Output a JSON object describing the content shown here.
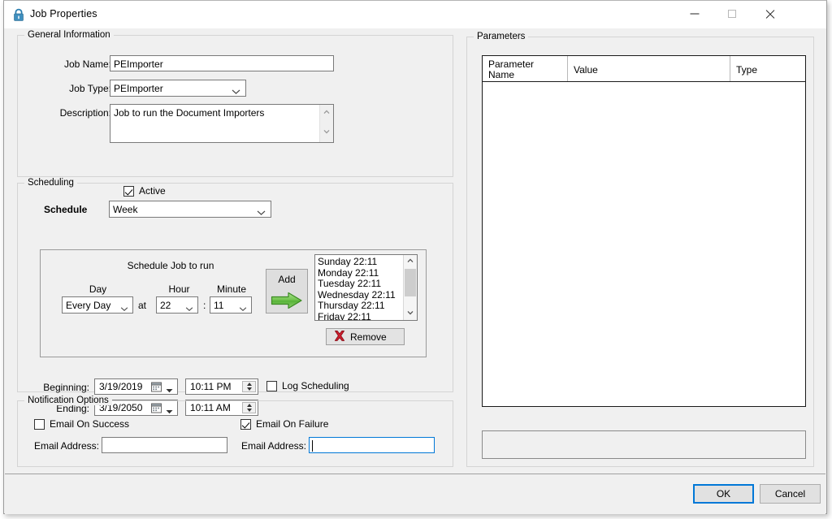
{
  "window": {
    "title": "Job Properties",
    "lock_icon": "lock-icon",
    "minimize_label": "Minimize",
    "maximize_label": "Maximize",
    "close_label": "Close"
  },
  "general": {
    "legend": "General Information",
    "job_name_label": "Job Name:",
    "job_name_value": "PEImporter",
    "job_type_label": "Job Type:",
    "job_type_value": "PEImporter",
    "description_label": "Description:",
    "description_value": "Job to run the Document Importers",
    "active_label": "Active",
    "active_checked": true
  },
  "scheduling": {
    "legend": "Scheduling",
    "schedule_label": "Schedule",
    "schedule_value": "Week",
    "panel_title": "Schedule Job to run",
    "day_label": "Day",
    "hour_label": "Hour",
    "minute_label": "Minute",
    "day_value": "Every Day",
    "at_label": "at",
    "colon_label": ":",
    "hour_value": "22",
    "minute_value": "11",
    "add_label": "Add",
    "add_icon": "green-arrow-right-icon",
    "remove_label": "Remove",
    "remove_icon": "red-x-icon",
    "entries": [
      "Sunday 22:11",
      "Monday 22:11",
      "Tuesday 22:11",
      "Wednesday 22:11",
      "Thursday 22:11",
      "Friday 22:11"
    ],
    "beginning_label": "Beginning:",
    "beginning_date": "3/19/2019",
    "beginning_time": "10:11 PM",
    "ending_label": "Ending:",
    "ending_date": "3/19/2050",
    "ending_time": "10:11 AM",
    "log_scheduling_label": "Log Scheduling",
    "log_scheduling_checked": false
  },
  "notification": {
    "legend": "Notification Options",
    "email_on_success_label": "Email On Success",
    "email_on_success_checked": false,
    "email_on_failure_label": "Email On Failure",
    "email_on_failure_checked": true,
    "success_address_label": "Email Address:",
    "success_address_value": "",
    "failure_address_label": "Email Address:",
    "failure_address_value": ""
  },
  "parameters": {
    "legend": "Parameters",
    "columns": [
      "Parameter\nName",
      "Value",
      "Type"
    ],
    "rows": [],
    "status_text": ""
  },
  "footer": {
    "ok_label": "OK",
    "cancel_label": "Cancel"
  },
  "colors": {
    "accent": "#0078d7",
    "window_bg": "#f0f0f0",
    "field_bg": "#ffffff",
    "arrow_green": "#5cb542",
    "x_red": "#c0182b",
    "lock_blue": "#2c7fb0"
  }
}
